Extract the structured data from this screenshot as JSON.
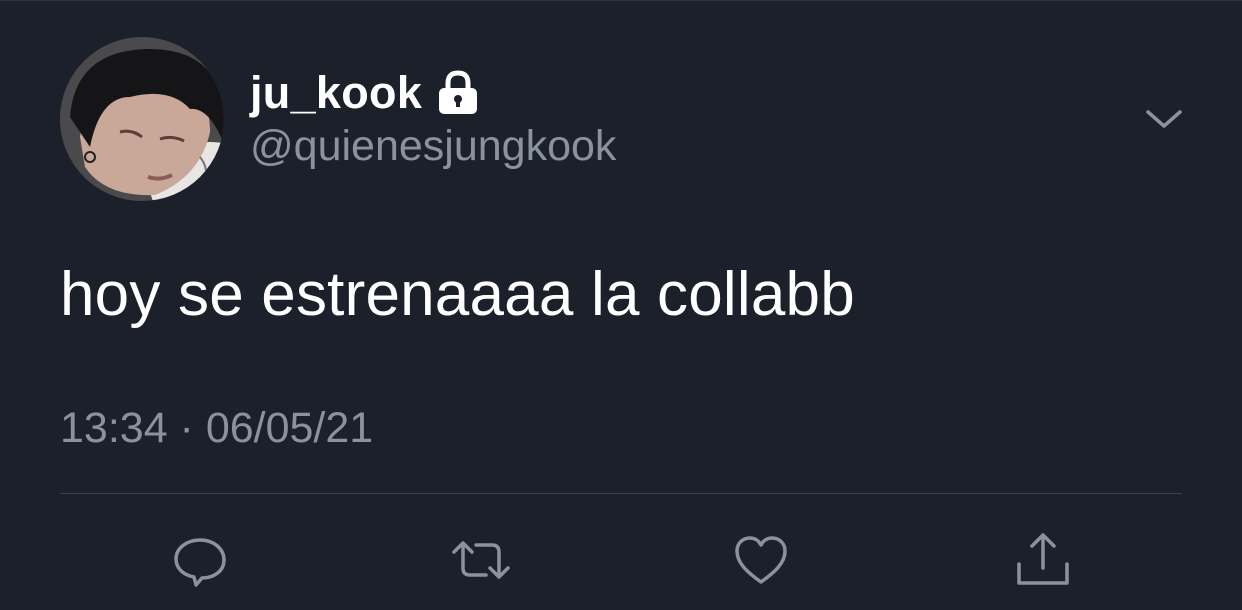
{
  "user": {
    "display_name": "ju_kook",
    "handle": "@quienesjungkook",
    "protected_icon": "lock-icon",
    "avatar_icon": "profile-photo"
  },
  "tweet": {
    "text": "hoy se estrenaaaa la collabb",
    "timestamp": "13:34 · 06/05/21"
  },
  "menu": {
    "icon": "chevron-down-icon"
  },
  "actions": [
    {
      "name": "reply",
      "icon": "comment-icon"
    },
    {
      "name": "retweet",
      "icon": "retweet-icon"
    },
    {
      "name": "like",
      "icon": "heart-icon"
    },
    {
      "name": "share",
      "icon": "share-icon"
    }
  ],
  "colors": {
    "background": "#1b202b",
    "primary_text": "#ffffff",
    "secondary_text": "#8a929c",
    "divider": "#39404c"
  }
}
